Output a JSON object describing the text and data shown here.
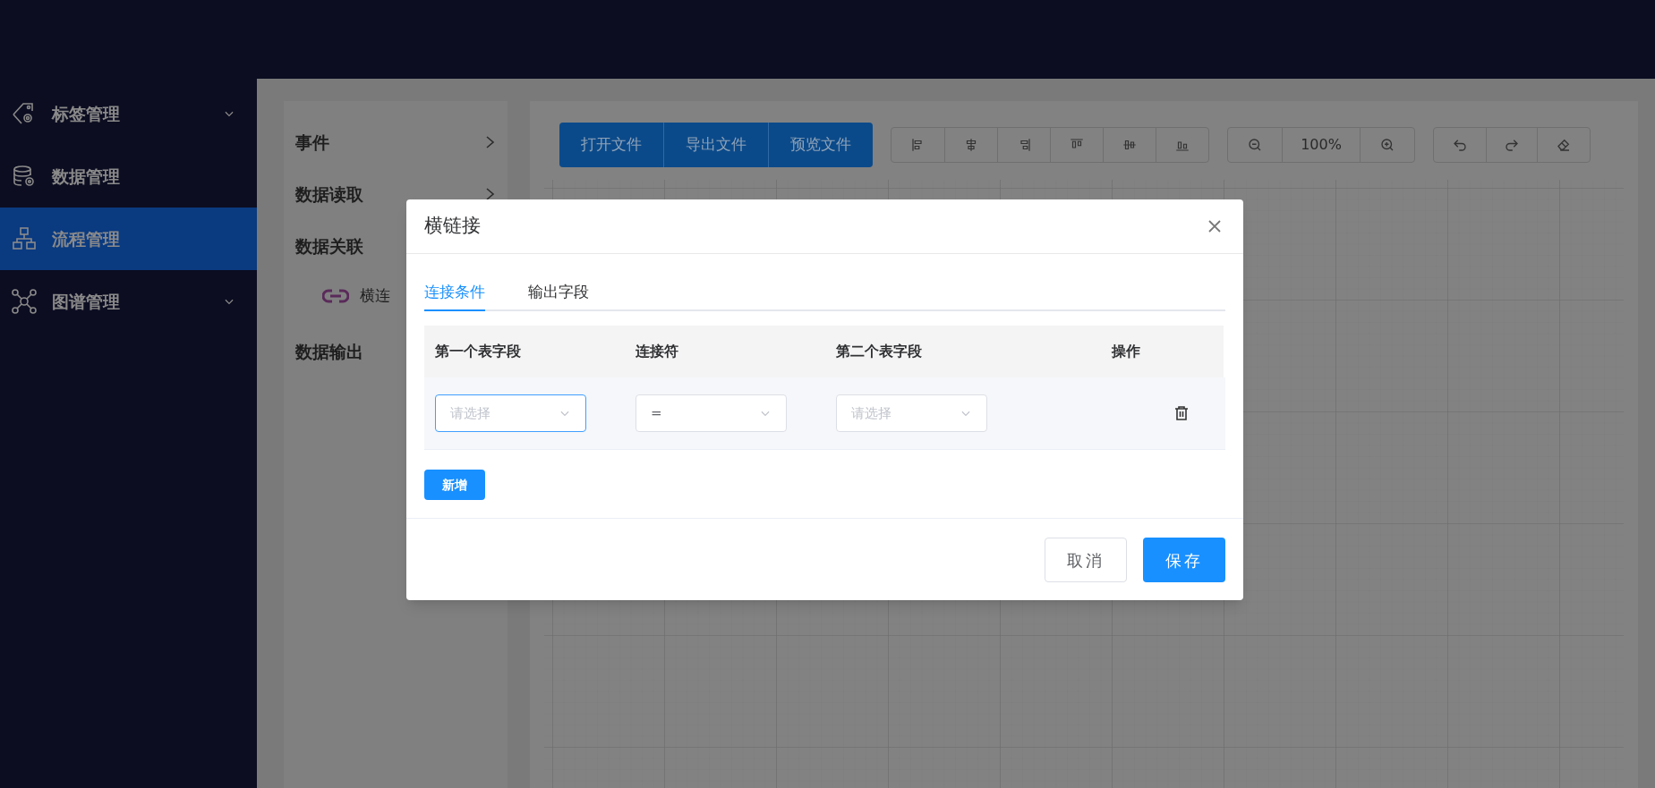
{
  "sidebar": {
    "items": [
      {
        "label": "标签管理",
        "expandable": true,
        "selected": false
      },
      {
        "label": "数据管理",
        "expandable": false,
        "selected": false
      },
      {
        "label": "流程管理",
        "expandable": false,
        "selected": true
      },
      {
        "label": "图谱管理",
        "expandable": true,
        "selected": false
      }
    ]
  },
  "panel": {
    "items": [
      {
        "label": "事件",
        "expandable": true
      },
      {
        "label": "数据读取",
        "expandable": true
      },
      {
        "label": "数据关联",
        "children": [
          {
            "label": "横连"
          }
        ]
      },
      {
        "label": "数据输出"
      }
    ]
  },
  "toolbar": {
    "file_buttons": [
      "打开文件",
      "导出文件",
      "预览文件"
    ],
    "zoom": "100%"
  },
  "dialog": {
    "title": "横链接",
    "tabs": [
      {
        "label": "连接条件",
        "selected": true
      },
      {
        "label": "输出字段",
        "selected": false
      }
    ],
    "table": {
      "columns": [
        "第一个表字段",
        "连接符",
        "第二个表字段",
        "操作"
      ],
      "rows": [
        {
          "first_field": {
            "placeholder": "请选择",
            "focused": true
          },
          "operator": {
            "value": "=",
            "focused": false
          },
          "second_field": {
            "placeholder": "请选择",
            "focused": false
          }
        }
      ]
    },
    "add_button": "新增",
    "buttons": [
      {
        "label": "取消",
        "kind": "default"
      },
      {
        "label": "保存",
        "kind": "primary"
      }
    ]
  }
}
